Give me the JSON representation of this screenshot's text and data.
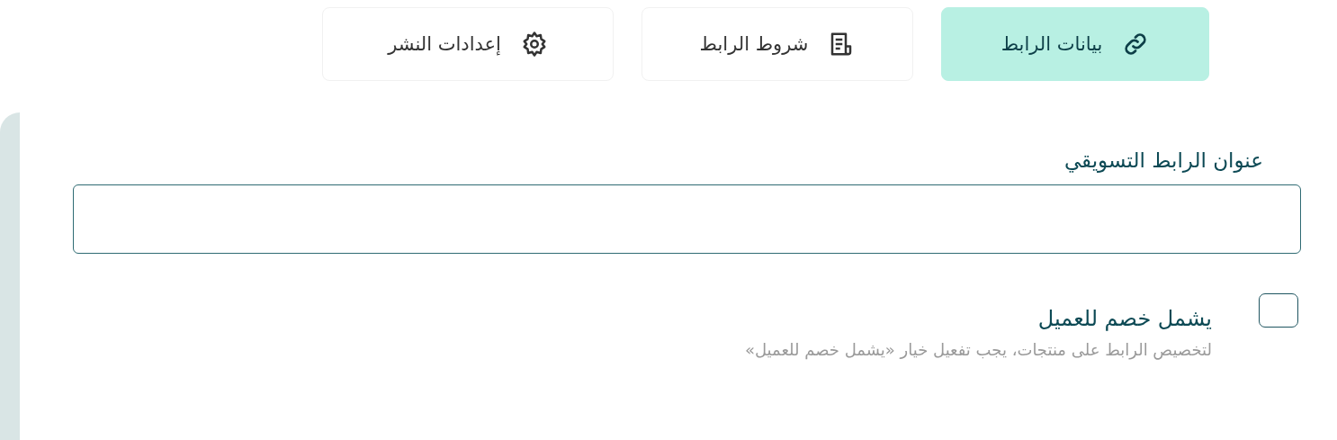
{
  "tabs": [
    {
      "label": "بيانات الرابط",
      "kind": "link",
      "selected": true
    },
    {
      "label": "شروط الرابط",
      "kind": "document",
      "selected": false
    },
    {
      "label": "إعدادات النشر",
      "kind": "gear",
      "selected": false
    }
  ],
  "title_field": {
    "label": "عنوان الرابط التسويقي"
  },
  "discount_option": {
    "label": "يشمل خصم للعميل",
    "hint": "لتخصيص الرابط على منتجات، يجب تفعيل خيار «يشمل خصم للعميل»",
    "checked": false
  }
}
